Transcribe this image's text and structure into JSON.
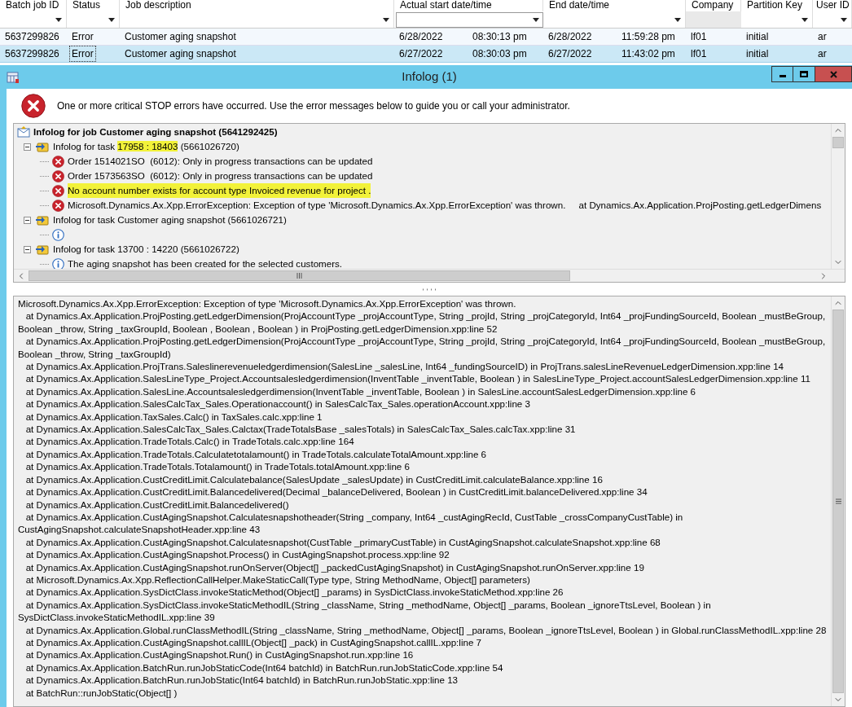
{
  "grid": {
    "columns": [
      {
        "label": "Batch job ID",
        "kind": "dropdown"
      },
      {
        "label": "Status",
        "kind": "dropdown"
      },
      {
        "label": "Job description",
        "kind": "dropdown"
      },
      {
        "label": "Actual start date/time",
        "kind": "field"
      },
      {
        "label": "End date/time",
        "kind": "dropdown"
      },
      {
        "label": "Company",
        "kind": "none"
      },
      {
        "label": "Partition Key",
        "kind": "dropdown"
      },
      {
        "label": "User ID",
        "kind": "dropdown"
      }
    ],
    "rows": [
      {
        "selected": false,
        "cells": [
          "5637299826",
          "Error",
          "Customer aging snapshot",
          [
            "6/28/2022",
            "08:30:13 pm"
          ],
          [
            "6/28/2022",
            "11:59:28 pm"
          ],
          "lf01",
          "initial",
          "ar"
        ]
      },
      {
        "selected": true,
        "cells": [
          "5637299826",
          "Error",
          "Customer aging snapshot",
          [
            "6/27/2022",
            "08:30:03 pm"
          ],
          [
            "6/27/2022",
            "11:43:02 pm"
          ],
          "lf01",
          "initial",
          "ar"
        ]
      }
    ]
  },
  "infolog": {
    "title": "Infolog (1)",
    "message": "One or more critical STOP errors have occurred. Use the error messages below to guide you or call your administrator.",
    "tree": [
      {
        "kind": "job",
        "text": "Infolog for job Customer aging snapshot (5641292425)",
        "children": [
          {
            "kind": "task",
            "expanded": true,
            "segments": [
              {
                "text": "Infolog for task ",
                "highlighted": false
              },
              {
                "text": "17958 : 18403",
                "highlighted": true
              },
              {
                "text": " (5661026720)",
                "highlighted": false
              }
            ],
            "children": [
              {
                "kind": "error",
                "text": "Order 1514021SO  (6012): Only in progress transactions can be updated",
                "highlighted": false
              },
              {
                "kind": "error",
                "text": "Order 1573563SO  (6012): Only in progress transactions can be updated",
                "highlighted": false
              },
              {
                "kind": "error",
                "text": "No account number exists for account type Invoiced revenue for project .",
                "highlighted": true
              },
              {
                "kind": "error",
                "text": "Microsoft.Dynamics.Ax.Xpp.ErrorException: Exception of type 'Microsoft.Dynamics.Ax.Xpp.ErrorException' was thrown.     at Dynamics.Ax.Application.ProjPosting.getLedgerDimens",
                "highlighted": false
              }
            ]
          },
          {
            "kind": "task",
            "expanded": true,
            "text": "Infolog for task Customer aging snapshot (5661026721)",
            "children": [
              {
                "kind": "info"
              }
            ]
          },
          {
            "kind": "task",
            "expanded": true,
            "text": "Infolog for task 13700 : 14220 (5661026722)",
            "children": [
              {
                "kind": "info",
                "text": "The aging snapshot has been created for the selected customers.",
                "highlighted": false
              }
            ]
          }
        ]
      }
    ],
    "trace": [
      "Microsoft.Dynamics.Ax.Xpp.ErrorException: Exception of type 'Microsoft.Dynamics.Ax.Xpp.ErrorException' was thrown.",
      "   at Dynamics.Ax.Application.ProjPosting.getLedgerDimension(ProjAccountType _projAccountType, String _projId, String _projCategoryId, Int64 _projFundingSourceId, Boolean _mustBeGroup, Boolean _throw, String _taxGroupId, Boolean , Boolean , Boolean ) in ProjPosting.getLedgerDimension.xpp:line 52",
      "   at Dynamics.Ax.Application.ProjPosting.getLedgerDimension(ProjAccountType _projAccountType, String _projId, String _projCategoryId, Int64 _projFundingSourceId, Boolean _mustBeGroup, Boolean _throw, String _taxGroupId)",
      "   at Dynamics.Ax.Application.ProjTrans.Saleslinerevenueledgerdimension(SalesLine _salesLine, Int64 _fundingSourceID) in ProjTrans.salesLineRevenueLedgerDimension.xpp:line 14",
      "   at Dynamics.Ax.Application.SalesLineType_Project.Accountsalesledgerdimension(InventTable _inventTable, Boolean ) in SalesLineType_Project.accountSalesLedgerDimension.xpp:line 11",
      "   at Dynamics.Ax.Application.SalesLine.Accountsalesledgerdimension(InventTable _inventTable, Boolean ) in SalesLine.accountSalesLedgerDimension.xpp:line 6",
      "   at Dynamics.Ax.Application.SalesCalcTax_Sales.Operationaccount() in SalesCalcTax_Sales.operationAccount.xpp:line 3",
      "   at Dynamics.Ax.Application.TaxSales.Calc() in TaxSales.calc.xpp:line 1",
      "   at Dynamics.Ax.Application.SalesCalcTax_Sales.Calctax(TradeTotalsBase _salesTotals) in SalesCalcTax_Sales.calcTax.xpp:line 31",
      "   at Dynamics.Ax.Application.TradeTotals.Calc() in TradeTotals.calc.xpp:line 164",
      "   at Dynamics.Ax.Application.TradeTotals.Calculatetotalamount() in TradeTotals.calculateTotalAmount.xpp:line 6",
      "   at Dynamics.Ax.Application.TradeTotals.Totalamount() in TradeTotals.totalAmount.xpp:line 6",
      "   at Dynamics.Ax.Application.CustCreditLimit.Calculatebalance(SalesUpdate _salesUpdate) in CustCreditLimit.calculateBalance.xpp:line 16",
      "   at Dynamics.Ax.Application.CustCreditLimit.Balancedelivered(Decimal _balanceDelivered, Boolean ) in CustCreditLimit.balanceDelivered.xpp:line 34",
      "   at Dynamics.Ax.Application.CustCreditLimit.Balancedelivered()",
      "   at Dynamics.Ax.Application.CustAgingSnapshot.Calculatesnapshotheader(String _company, Int64 _custAgingRecId, CustTable _crossCompanyCustTable) in CustAgingSnapshot.calculateSnapshotHeader.xpp:line 43",
      "   at Dynamics.Ax.Application.CustAgingSnapshot.Calculatesnapshot(CustTable _primaryCustTable) in CustAgingSnapshot.calculateSnapshot.xpp:line 68",
      "   at Dynamics.Ax.Application.CustAgingSnapshot.Process() in CustAgingSnapshot.process.xpp:line 92",
      "   at Dynamics.Ax.Application.CustAgingSnapshot.runOnServer(Object[] _packedCustAgingSnapshot) in CustAgingSnapshot.runOnServer.xpp:line 19",
      "   at Microsoft.Dynamics.Ax.Xpp.ReflectionCallHelper.MakeStaticCall(Type type, String MethodName, Object[] parameters)",
      "   at Dynamics.Ax.Application.SysDictClass.invokeStaticMethod(Object[] _params) in SysDictClass.invokeStaticMethod.xpp:line 26",
      "   at Dynamics.Ax.Application.SysDictClass.invokeStaticMethodIL(String _className, String _methodName, Object[] _params, Boolean _ignoreTtsLevel, Boolean ) in SysDictClass.invokeStaticMethodIL.xpp:line 39",
      "   at Dynamics.Ax.Application.Global.runClassMethodIL(String _className, String _methodName, Object[] _params, Boolean _ignoreTtsLevel, Boolean ) in Global.runClassMethodIL.xpp:line 28",
      "   at Dynamics.Ax.Application.CustAgingSnapshot.callIL(Object[] _pack) in CustAgingSnapshot.callIL.xpp:line 7",
      "   at Dynamics.Ax.Application.CustAgingSnapshot.Run() in CustAgingSnapshot.run.xpp:line 16",
      "   at Dynamics.Ax.Application.BatchRun.runJobStaticCode(Int64 batchId) in BatchRun.runJobStaticCode.xpp:line 54",
      "   at Dynamics.Ax.Application.BatchRun.runJobStatic(Int64 batchId) in BatchRun.runJobStatic.xpp:line 13",
      "   at BatchRun::runJobStatic(Object[] )"
    ]
  }
}
